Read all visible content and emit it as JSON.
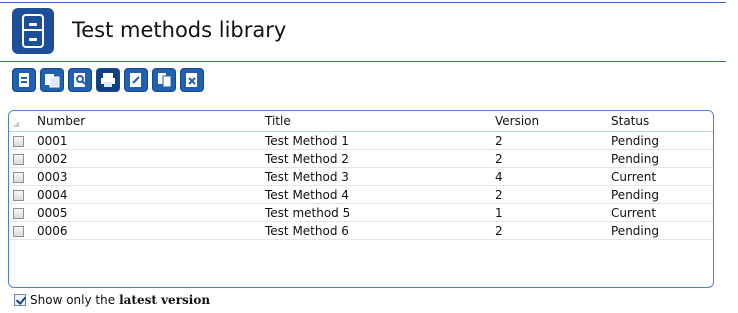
{
  "header": {
    "title": "Test methods library"
  },
  "toolbar": {
    "icons": [
      "add-document-icon",
      "copy-document-icon",
      "search-document-icon",
      "print-icon",
      "edit-document-icon",
      "duplicate-document-icon",
      "delete-document-icon"
    ]
  },
  "table": {
    "columns": [
      "Number",
      "Title",
      "Version",
      "Status"
    ],
    "rows": [
      {
        "number": "0001",
        "title": "Test Method 1",
        "version": "2",
        "status": "Pending"
      },
      {
        "number": "0002",
        "title": "Test Method 2",
        "version": "2",
        "status": "Pending"
      },
      {
        "number": "0003",
        "title": "Test Method 3",
        "version": "4",
        "status": "Current"
      },
      {
        "number": "0004",
        "title": "Test Method 4",
        "version": "2",
        "status": "Pending"
      },
      {
        "number": "0005",
        "title": "Test method 5",
        "version": "1",
        "status": "Current"
      },
      {
        "number": "0006",
        "title": "Test Method 6",
        "version": "2",
        "status": "Pending"
      }
    ]
  },
  "footer": {
    "checkbox_prefix": "Show only the",
    "checkbox_bold": "latest version",
    "checked": true
  },
  "colors": {
    "accent": "#1f61b0",
    "border": "#4a7fc9"
  }
}
